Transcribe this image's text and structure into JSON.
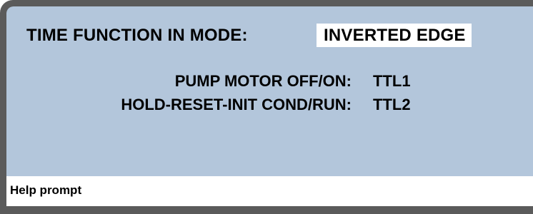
{
  "header": {
    "title_label": "TIME FUNCTION IN MODE:",
    "mode_value": "INVERTED EDGE"
  },
  "settings": [
    {
      "label": "PUMP MOTOR OFF/ON:",
      "value": "TTL1"
    },
    {
      "label": "HOLD-RESET-INIT COND/RUN:",
      "value": "TTL2"
    }
  ],
  "footer": {
    "help_prompt": "Help prompt"
  },
  "colors": {
    "bezel": "#5b5b5b",
    "screen_background": "#b3c6db",
    "highlight_background": "#ffffff",
    "text": "#000000"
  }
}
